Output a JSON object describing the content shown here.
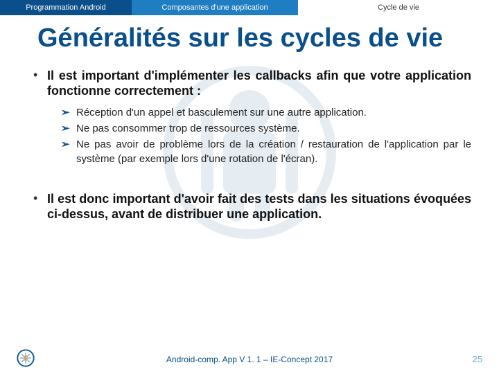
{
  "ribbon": {
    "left": "Programmation Android",
    "mid": "Composantes d'une application",
    "right": "Cycle de vie"
  },
  "title": "Généralités sur les cycles de vie",
  "bullets": [
    {
      "text": "Il est important d'implémenter les callbacks afin que votre application fonctionne correctement :",
      "sub": [
        "Réception d'un appel et basculement sur une autre application.",
        "Ne pas consommer trop de ressources système.",
        "Ne pas avoir de problème lors de la création / restauration de l'application par le système (par exemple lors d'une rotation de l'écran)."
      ]
    },
    {
      "text": "Il est donc important d'avoir fait des tests dans les situations évoquées ci-dessus, avant de distribuer une application.",
      "sub": []
    }
  ],
  "footer": "Android-comp. App V 1. 1 – IE-Concept 2017",
  "page": "25"
}
